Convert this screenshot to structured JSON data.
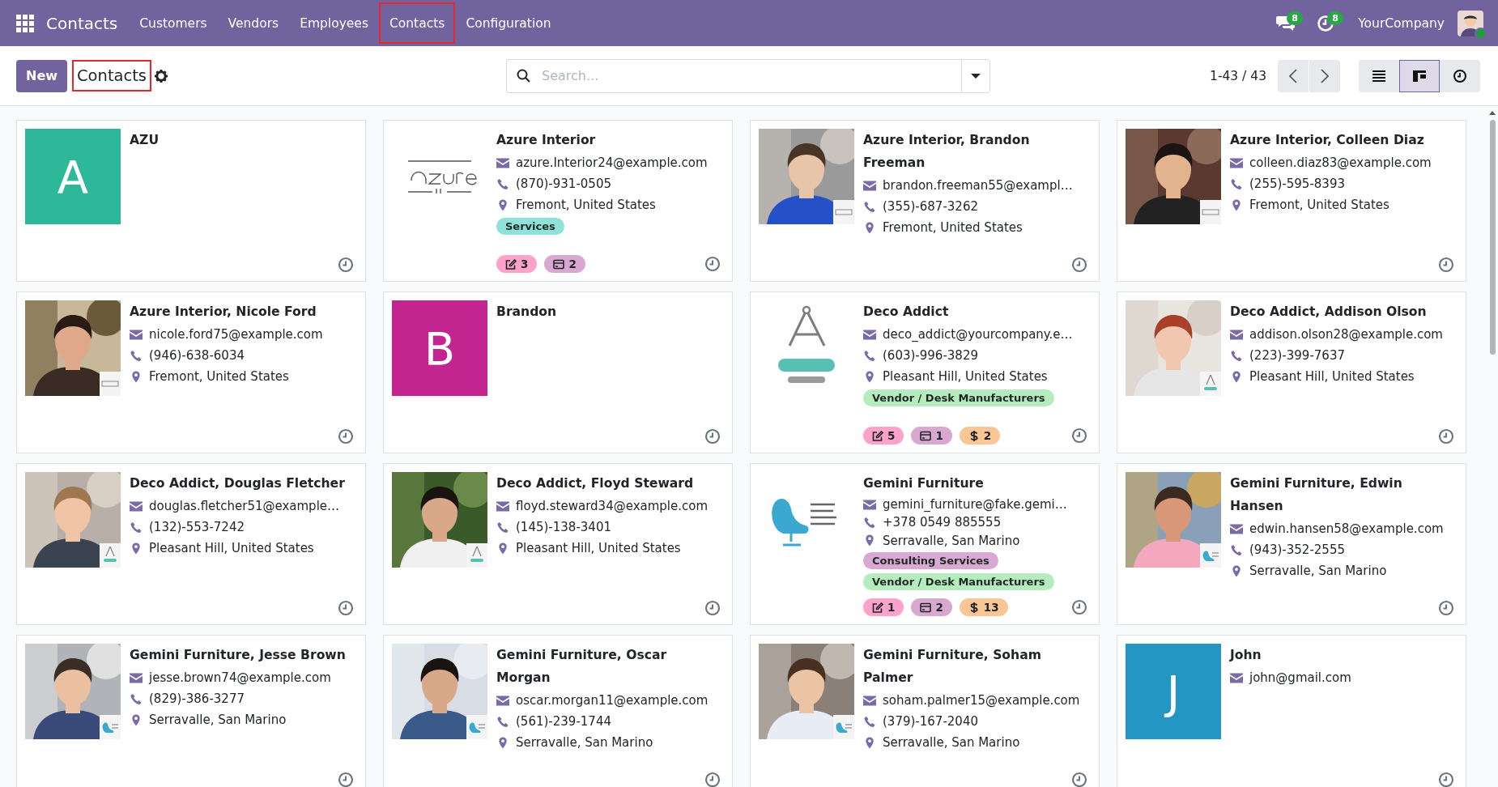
{
  "navbar": {
    "app_title": "Contacts",
    "menu": [
      {
        "label": "Customers",
        "highlighted": false
      },
      {
        "label": "Vendors",
        "highlighted": false
      },
      {
        "label": "Employees",
        "highlighted": false
      },
      {
        "label": "Contacts",
        "highlighted": true
      },
      {
        "label": "Configuration",
        "highlighted": false
      }
    ],
    "messages_badge": "8",
    "activities_badge": "8",
    "company": "YourCompany"
  },
  "control_panel": {
    "new_button": "New",
    "breadcrumb": {
      "label": "Contacts",
      "highlighted": true
    },
    "search": {
      "placeholder": "Search..."
    },
    "pager": "1-43 / 43",
    "views": [
      {
        "kind": "list",
        "selected": false
      },
      {
        "kind": "kanban",
        "selected": true
      },
      {
        "kind": "activity",
        "selected": false
      }
    ]
  },
  "cards": [
    {
      "name": "AZU",
      "avatar": {
        "kind": "letter",
        "letter": "A",
        "color": "#2eb89a"
      }
    },
    {
      "name": "Azure Interior",
      "avatar": {
        "kind": "azure-logo"
      },
      "details": [
        {
          "kind": "email",
          "text": "azure.Interior24@example.com"
        },
        {
          "kind": "phone",
          "text": "(870)-931-0505"
        },
        {
          "kind": "address",
          "text": "Fremont, United States"
        }
      ],
      "tags": [
        {
          "label": "Services",
          "color": "#8ee2da"
        }
      ],
      "counters": [
        {
          "kind": "notes",
          "count": "3",
          "color": "#fda2cb"
        },
        {
          "kind": "invoices",
          "count": "2",
          "color": "#d9a8d1"
        }
      ]
    },
    {
      "name": "Azure Interior, Brandon Freeman",
      "avatar": {
        "kind": "picture",
        "badge": {
          "kind": "azure"
        }
      },
      "details": [
        {
          "kind": "email",
          "text": "brandon.freeman55@exampl…"
        },
        {
          "kind": "phone",
          "text": "(355)-687-3262"
        },
        {
          "kind": "address",
          "text": "Fremont, United States"
        }
      ]
    },
    {
      "name": "Azure Interior, Colleen Diaz",
      "avatar": {
        "kind": "picture",
        "badge": {
          "kind": "azure"
        }
      },
      "details": [
        {
          "kind": "email",
          "text": "colleen.diaz83@example.com"
        },
        {
          "kind": "phone",
          "text": "(255)-595-8393"
        },
        {
          "kind": "address",
          "text": "Fremont, United States"
        }
      ]
    },
    {
      "name": "Azure Interior, Nicole Ford",
      "avatar": {
        "kind": "picture",
        "badge": {
          "kind": "azure"
        }
      },
      "details": [
        {
          "kind": "email",
          "text": "nicole.ford75@example.com"
        },
        {
          "kind": "phone",
          "text": "(946)-638-6034"
        },
        {
          "kind": "address",
          "text": "Fremont, United States"
        }
      ]
    },
    {
      "name": "Brandon",
      "avatar": {
        "kind": "letter",
        "letter": "B",
        "color": "#c2258f"
      }
    },
    {
      "name": "Deco Addict",
      "avatar": {
        "kind": "compass-logo"
      },
      "details": [
        {
          "kind": "email",
          "text": "deco_addict@yourcompany.e…"
        },
        {
          "kind": "phone",
          "text": "(603)-996-3829"
        },
        {
          "kind": "address",
          "text": "Pleasant Hill, United States"
        }
      ],
      "tags": [
        {
          "label": "Vendor / Desk Manufacturers",
          "color": "#b5ebbf"
        }
      ],
      "counters": [
        {
          "kind": "notes",
          "count": "5",
          "color": "#fda2cb"
        },
        {
          "kind": "invoices",
          "count": "1",
          "color": "#d9a8d1"
        },
        {
          "kind": "sales",
          "count": "2",
          "color": "#f9c796"
        }
      ]
    },
    {
      "name": "Deco Addict, Addison Olson",
      "avatar": {
        "kind": "picture",
        "badge": {
          "kind": "compass"
        }
      },
      "details": [
        {
          "kind": "email",
          "text": "addison.olson28@example.com"
        },
        {
          "kind": "phone",
          "text": "(223)-399-7637"
        },
        {
          "kind": "address",
          "text": "Pleasant Hill, United States"
        }
      ]
    },
    {
      "name": "Deco Addict, Douglas Fletcher",
      "avatar": {
        "kind": "picture",
        "badge": {
          "kind": "compass"
        }
      },
      "details": [
        {
          "kind": "email",
          "text": "douglas.fletcher51@example…"
        },
        {
          "kind": "phone",
          "text": "(132)-553-7242"
        },
        {
          "kind": "address",
          "text": "Pleasant Hill, United States"
        }
      ]
    },
    {
      "name": "Deco Addict, Floyd Steward",
      "avatar": {
        "kind": "picture",
        "badge": {
          "kind": "compass"
        }
      },
      "details": [
        {
          "kind": "email",
          "text": "floyd.steward34@example.com"
        },
        {
          "kind": "phone",
          "text": "(145)-138-3401"
        },
        {
          "kind": "address",
          "text": "Pleasant Hill, United States"
        }
      ]
    },
    {
      "name": "Gemini Furniture",
      "avatar": {
        "kind": "chair-logo"
      },
      "details": [
        {
          "kind": "email",
          "text": "gemini_furniture@fake.gemi…"
        },
        {
          "kind": "phone",
          "text": "+378 0549 885555"
        },
        {
          "kind": "address",
          "text": "Serravalle, San Marino"
        }
      ],
      "tags": [
        {
          "label": "Consulting Services",
          "color": "#d9a8d3"
        },
        {
          "label": "Vendor / Desk Manufacturers",
          "color": "#b5ebbf"
        }
      ],
      "counters": [
        {
          "kind": "notes",
          "count": "1",
          "color": "#fda2cb"
        },
        {
          "kind": "invoices",
          "count": "2",
          "color": "#d9a8d1"
        },
        {
          "kind": "sales",
          "count": "13",
          "color": "#f9c796"
        }
      ]
    },
    {
      "name": "Gemini Furniture, Edwin Hansen",
      "avatar": {
        "kind": "picture",
        "badge": {
          "kind": "chair"
        }
      },
      "details": [
        {
          "kind": "email",
          "text": "edwin.hansen58@example.com"
        },
        {
          "kind": "phone",
          "text": "(943)-352-2555"
        },
        {
          "kind": "address",
          "text": "Serravalle, San Marino"
        }
      ]
    },
    {
      "name": "Gemini Furniture, Jesse Brown",
      "avatar": {
        "kind": "picture",
        "badge": {
          "kind": "chair"
        }
      },
      "details": [
        {
          "kind": "email",
          "text": "jesse.brown74@example.com"
        },
        {
          "kind": "phone",
          "text": "(829)-386-3277"
        },
        {
          "kind": "address",
          "text": "Serravalle, San Marino"
        }
      ]
    },
    {
      "name": "Gemini Furniture, Oscar Morgan",
      "avatar": {
        "kind": "picture",
        "badge": {
          "kind": "chair"
        }
      },
      "details": [
        {
          "kind": "email",
          "text": "oscar.morgan11@example.com"
        },
        {
          "kind": "phone",
          "text": "(561)-239-1744"
        },
        {
          "kind": "address",
          "text": "Serravalle, San Marino"
        }
      ]
    },
    {
      "name": "Gemini Furniture, Soham Palmer",
      "avatar": {
        "kind": "picture",
        "badge": {
          "kind": "chair"
        }
      },
      "details": [
        {
          "kind": "email",
          "text": "soham.palmer15@example.com"
        },
        {
          "kind": "phone",
          "text": "(379)-167-2040"
        },
        {
          "kind": "address",
          "text": "Serravalle, San Marino"
        }
      ]
    },
    {
      "name": "John",
      "avatar": {
        "kind": "letter",
        "letter": "J",
        "color": "#2496c4"
      },
      "details": [
        {
          "kind": "email",
          "text": "john@gmail.com"
        }
      ]
    }
  ]
}
